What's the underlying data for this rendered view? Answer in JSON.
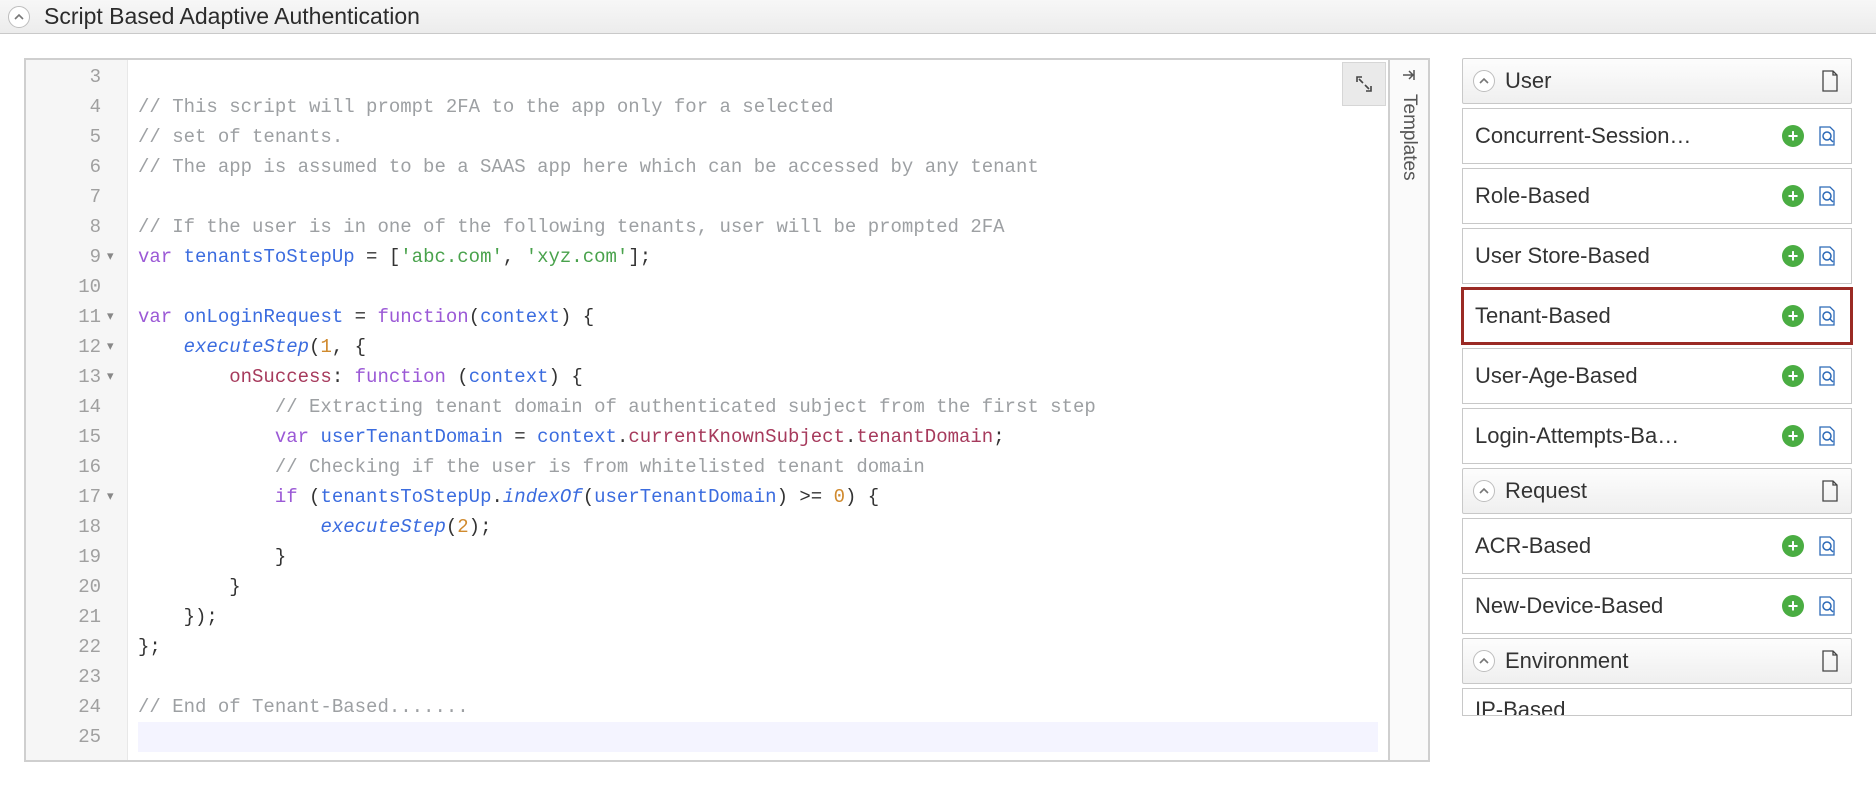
{
  "panel": {
    "title": "Script Based Adaptive Authentication"
  },
  "editor": {
    "lines": [
      {
        "n": 3,
        "fold": "",
        "tokens": []
      },
      {
        "n": 4,
        "fold": "",
        "tokens": [
          {
            "t": "comment",
            "v": "// This script will prompt 2FA to the app only for a selected"
          }
        ]
      },
      {
        "n": 5,
        "fold": "",
        "tokens": [
          {
            "t": "comment",
            "v": "// set of tenants."
          }
        ]
      },
      {
        "n": 6,
        "fold": "",
        "tokens": [
          {
            "t": "comment",
            "v": "// The app is assumed to be a SAAS app here which can be accessed by any tenant"
          }
        ]
      },
      {
        "n": 7,
        "fold": "",
        "tokens": []
      },
      {
        "n": 8,
        "fold": "",
        "tokens": [
          {
            "t": "comment",
            "v": "// If the user is in one of the following tenants, user will be prompted 2FA"
          }
        ]
      },
      {
        "n": 9,
        "fold": "▾",
        "tokens": [
          {
            "t": "keyword",
            "v": "var"
          },
          {
            "t": "text",
            "v": " "
          },
          {
            "t": "var",
            "v": "tenantsToStepUp"
          },
          {
            "t": "text",
            "v": " = ["
          },
          {
            "t": "string",
            "v": "'abc.com'"
          },
          {
            "t": "text",
            "v": ", "
          },
          {
            "t": "string",
            "v": "'xyz.com'"
          },
          {
            "t": "text",
            "v": "];"
          }
        ]
      },
      {
        "n": 10,
        "fold": "",
        "tokens": []
      },
      {
        "n": 11,
        "fold": "▾",
        "tokens": [
          {
            "t": "keyword",
            "v": "var"
          },
          {
            "t": "text",
            "v": " "
          },
          {
            "t": "var",
            "v": "onLoginRequest"
          },
          {
            "t": "text",
            "v": " = "
          },
          {
            "t": "keyword",
            "v": "function"
          },
          {
            "t": "text",
            "v": "("
          },
          {
            "t": "var",
            "v": "context"
          },
          {
            "t": "text",
            "v": ") {"
          }
        ]
      },
      {
        "n": 12,
        "fold": "▾",
        "tokens": [
          {
            "t": "text",
            "v": "    "
          },
          {
            "t": "func",
            "v": "executeStep"
          },
          {
            "t": "text",
            "v": "("
          },
          {
            "t": "num",
            "v": "1"
          },
          {
            "t": "text",
            "v": ", {"
          }
        ]
      },
      {
        "n": 13,
        "fold": "▾",
        "tokens": [
          {
            "t": "text",
            "v": "        "
          },
          {
            "t": "prop",
            "v": "onSuccess"
          },
          {
            "t": "text",
            "v": ": "
          },
          {
            "t": "keyword",
            "v": "function"
          },
          {
            "t": "text",
            "v": " ("
          },
          {
            "t": "var",
            "v": "context"
          },
          {
            "t": "text",
            "v": ") {"
          }
        ]
      },
      {
        "n": 14,
        "fold": "",
        "tokens": [
          {
            "t": "text",
            "v": "            "
          },
          {
            "t": "comment",
            "v": "// Extracting tenant domain of authenticated subject from the first step"
          }
        ]
      },
      {
        "n": 15,
        "fold": "",
        "tokens": [
          {
            "t": "text",
            "v": "            "
          },
          {
            "t": "keyword",
            "v": "var"
          },
          {
            "t": "text",
            "v": " "
          },
          {
            "t": "var",
            "v": "userTenantDomain"
          },
          {
            "t": "text",
            "v": " = "
          },
          {
            "t": "var",
            "v": "context"
          },
          {
            "t": "text",
            "v": "."
          },
          {
            "t": "prop",
            "v": "currentKnownSubject"
          },
          {
            "t": "text",
            "v": "."
          },
          {
            "t": "prop",
            "v": "tenantDomain"
          },
          {
            "t": "text",
            "v": ";"
          }
        ]
      },
      {
        "n": 16,
        "fold": "",
        "tokens": [
          {
            "t": "text",
            "v": "            "
          },
          {
            "t": "comment",
            "v": "// Checking if the user is from whitelisted tenant domain"
          }
        ]
      },
      {
        "n": 17,
        "fold": "▾",
        "tokens": [
          {
            "t": "text",
            "v": "            "
          },
          {
            "t": "keyword",
            "v": "if"
          },
          {
            "t": "text",
            "v": " ("
          },
          {
            "t": "var",
            "v": "tenantsToStepUp"
          },
          {
            "t": "text",
            "v": "."
          },
          {
            "t": "func",
            "v": "indexOf"
          },
          {
            "t": "text",
            "v": "("
          },
          {
            "t": "var",
            "v": "userTenantDomain"
          },
          {
            "t": "text",
            "v": ") >= "
          },
          {
            "t": "num",
            "v": "0"
          },
          {
            "t": "text",
            "v": ") {"
          }
        ]
      },
      {
        "n": 18,
        "fold": "",
        "tokens": [
          {
            "t": "text",
            "v": "                "
          },
          {
            "t": "func",
            "v": "executeStep"
          },
          {
            "t": "text",
            "v": "("
          },
          {
            "t": "num",
            "v": "2"
          },
          {
            "t": "text",
            "v": ");"
          }
        ]
      },
      {
        "n": 19,
        "fold": "",
        "tokens": [
          {
            "t": "text",
            "v": "            }"
          }
        ]
      },
      {
        "n": 20,
        "fold": "",
        "tokens": [
          {
            "t": "text",
            "v": "        }"
          }
        ]
      },
      {
        "n": 21,
        "fold": "",
        "tokens": [
          {
            "t": "text",
            "v": "    });"
          }
        ]
      },
      {
        "n": 22,
        "fold": "",
        "tokens": [
          {
            "t": "text",
            "v": "};"
          }
        ]
      },
      {
        "n": 23,
        "fold": "",
        "tokens": []
      },
      {
        "n": 24,
        "fold": "",
        "tokens": [
          {
            "t": "comment",
            "v": "// End of Tenant-Based......."
          }
        ]
      },
      {
        "n": 25,
        "fold": "",
        "tokens": [],
        "active": true
      }
    ]
  },
  "templates": {
    "rail_label": "Templates",
    "groups": [
      {
        "title": "User",
        "icon": "user-doc-icon",
        "items": [
          {
            "name": "Concurrent-Session…"
          },
          {
            "name": "Role-Based"
          },
          {
            "name": "User Store-Based"
          },
          {
            "name": "Tenant-Based",
            "highlighted": true
          },
          {
            "name": "User-Age-Based"
          },
          {
            "name": "Login-Attempts-Ba…"
          }
        ]
      },
      {
        "title": "Request",
        "icon": "request-doc-icon",
        "items": [
          {
            "name": "ACR-Based"
          },
          {
            "name": "New-Device-Based"
          }
        ]
      },
      {
        "title": "Environment",
        "icon": "env-doc-icon",
        "items": [
          {
            "name": "IP-Based",
            "partial": true
          }
        ]
      }
    ]
  }
}
